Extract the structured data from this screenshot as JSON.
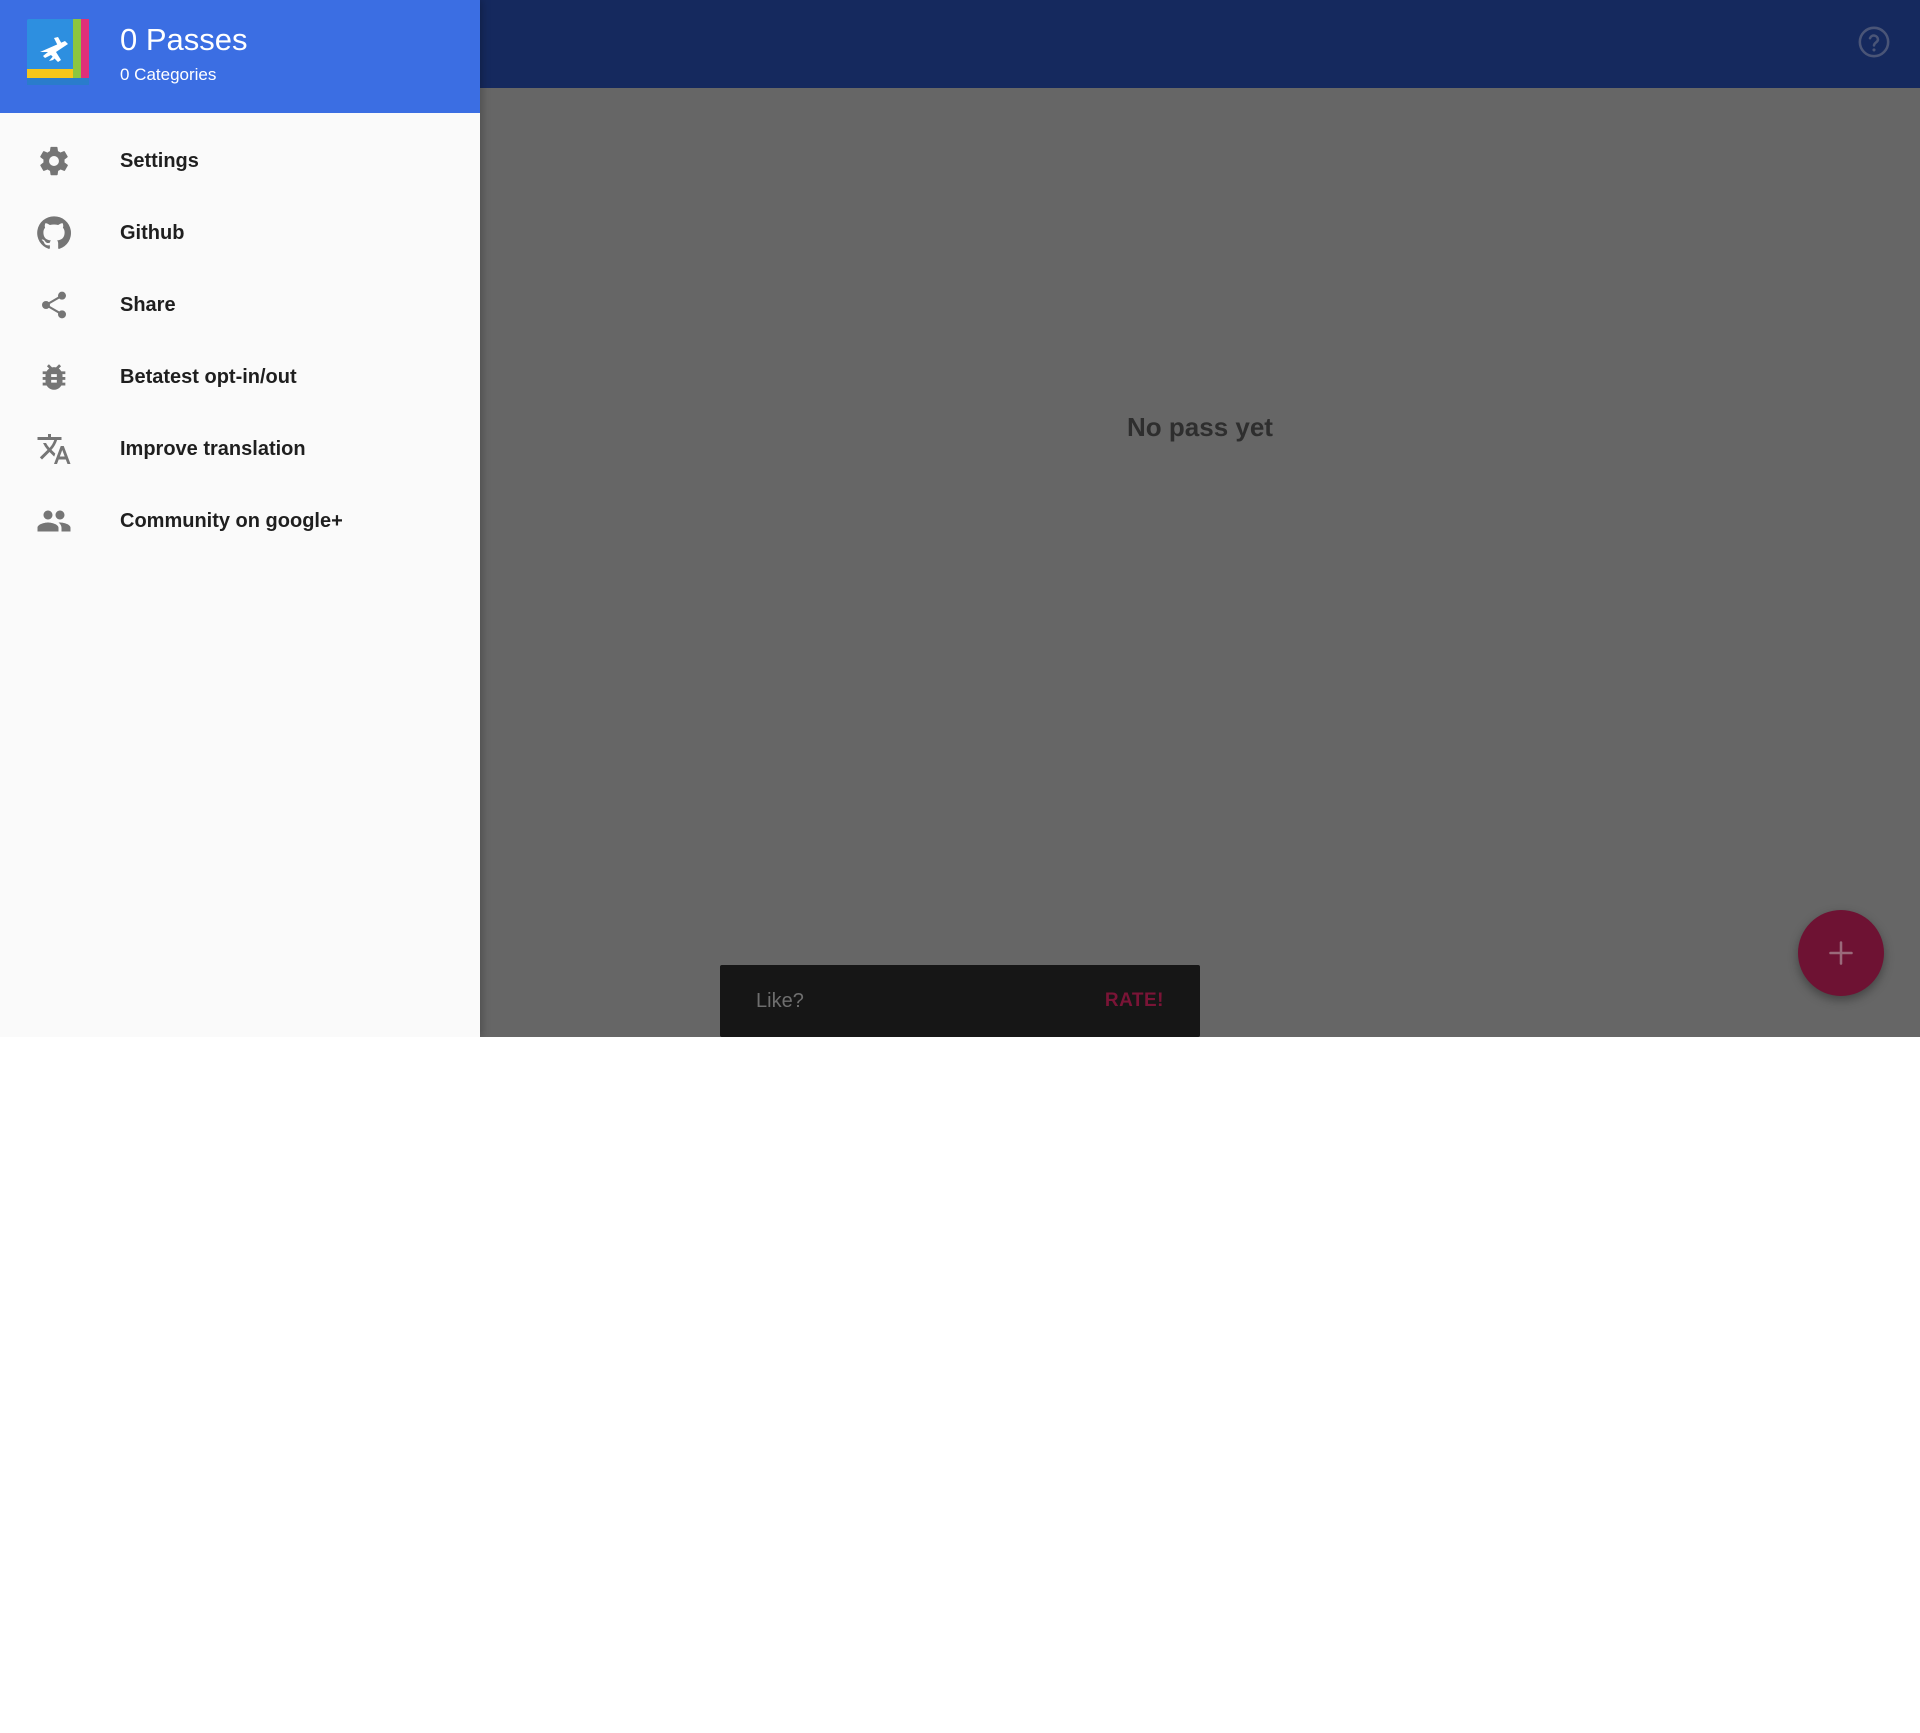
{
  "drawer": {
    "header": {
      "title": "0 Passes",
      "subtitle": "0 Categories",
      "logo_icon": "app-logo-plane-icon"
    },
    "items": [
      {
        "label": "Settings",
        "icon": "gear-icon"
      },
      {
        "label": "Github",
        "icon": "github-icon"
      },
      {
        "label": "Share",
        "icon": "share-icon"
      },
      {
        "label": "Betatest opt-in/out",
        "icon": "bug-icon"
      },
      {
        "label": "Improve translation",
        "icon": "translate-icon"
      },
      {
        "label": "Community on google+",
        "icon": "people-icon"
      }
    ]
  },
  "appbar": {
    "help_icon": "help-circle-icon"
  },
  "main": {
    "empty_message": "No pass yet"
  },
  "snackbar": {
    "message": "Like?",
    "action": "RATE!"
  },
  "fab": {
    "icon": "plus-icon"
  },
  "colors": {
    "drawer_header": "#3b6ee3",
    "appbar_dimmed": "#15295e",
    "scrim_content": "#666666",
    "accent_dimmed": "#6e1233",
    "drawer_bg": "#fafafa"
  }
}
